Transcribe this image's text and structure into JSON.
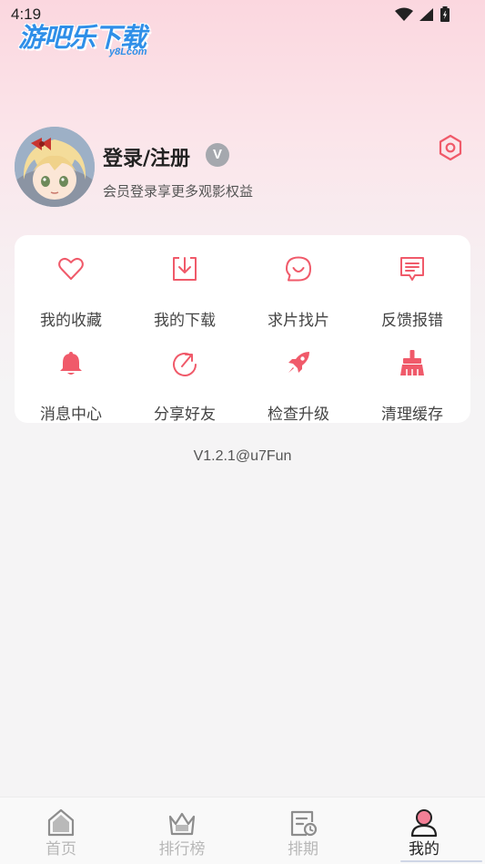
{
  "status_bar": {
    "time": "4:19"
  },
  "logo": {
    "main": "游吧乐下载",
    "sub": "y8Lcom"
  },
  "profile": {
    "title": "登录/注册",
    "vip_badge": "V",
    "subtitle": "会员登录享更多观影权益"
  },
  "menu": {
    "items": [
      {
        "label": "我的收藏",
        "icon": "heart-icon"
      },
      {
        "label": "我的下载",
        "icon": "download-icon"
      },
      {
        "label": "求片找片",
        "icon": "chat-smile-icon"
      },
      {
        "label": "反馈报错",
        "icon": "feedback-icon"
      },
      {
        "label": "消息中心",
        "icon": "bell-icon"
      },
      {
        "label": "分享好友",
        "icon": "share-icon"
      },
      {
        "label": "检查升级",
        "icon": "rocket-icon"
      },
      {
        "label": "清理缓存",
        "icon": "broom-icon"
      }
    ]
  },
  "version": "V1.2.1@u7Fun",
  "bottom_nav": {
    "items": [
      {
        "label": "首页",
        "icon": "home-icon"
      },
      {
        "label": "排行榜",
        "icon": "ranking-icon"
      },
      {
        "label": "排期",
        "icon": "schedule-icon"
      },
      {
        "label": "我的",
        "icon": "profile-icon"
      }
    ],
    "active": "我的"
  },
  "colors": {
    "accent": "#f05a6a",
    "card_background": "#ffffff",
    "page_background": "#f5f4f5",
    "logo_blue": "#2f8fe8"
  }
}
